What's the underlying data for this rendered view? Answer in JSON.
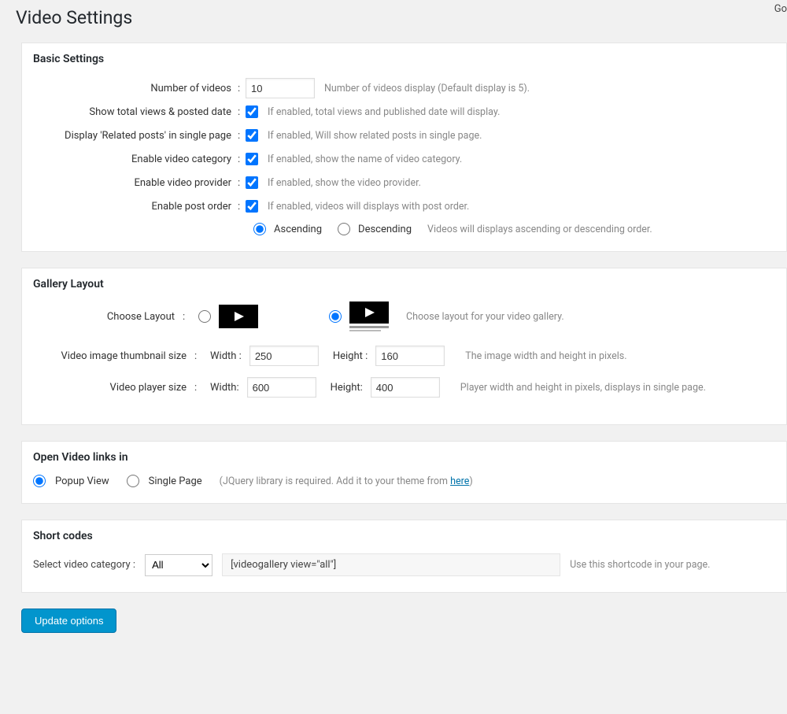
{
  "topRight": "Go",
  "pageTitle": "Video Settings",
  "basic": {
    "heading": "Basic Settings",
    "rows": {
      "numVideos": {
        "label": "Number of videos",
        "value": "10",
        "hint": "Number of videos display (Default display is 5)."
      },
      "showViews": {
        "label": "Show total views & posted date",
        "checked": true,
        "hint": "If enabled, total views and published date will display."
      },
      "related": {
        "label": "Display 'Related posts' in single page",
        "checked": true,
        "hint": "If enabled, Will show related posts in single page."
      },
      "category": {
        "label": "Enable video category",
        "checked": true,
        "hint": "If enabled, show the name of video category."
      },
      "provider": {
        "label": "Enable video provider",
        "checked": true,
        "hint": "If enabled, show the video provider."
      },
      "postOrder": {
        "label": "Enable post order",
        "checked": true,
        "hint": "If enabled, videos will displays with post order."
      }
    },
    "sort": {
      "asc": "Ascending",
      "desc": "Descending",
      "selected": "asc",
      "hint": "Videos will displays ascending or descending order."
    }
  },
  "gallery": {
    "heading": "Gallery Layout",
    "chooseLabel": "Choose Layout",
    "selected": "caption",
    "hint": "Choose layout for your video gallery.",
    "thumbSize": {
      "label": "Video image thumbnail size",
      "widthLabel": "Width :",
      "width": "250",
      "heightLabel": "Height :",
      "height": "160",
      "hint": "The image width and height in pixels."
    },
    "playerSize": {
      "label": "Video player size",
      "widthLabel": "Width:",
      "width": "600",
      "heightLabel": "Height:",
      "height": "400",
      "hint": "Player width and height in pixels, displays in single page."
    }
  },
  "openIn": {
    "heading": "Open Video links in",
    "popup": "Popup View",
    "single": "Single Page",
    "selected": "popup",
    "hintPrefix": "(JQuery library is required. Add it to your theme from ",
    "hintLink": "here",
    "hintSuffix": ")"
  },
  "shortcodes": {
    "heading": "Short codes",
    "selectLabel": "Select video category :",
    "selected": "All",
    "options": [
      "All"
    ],
    "code": "[videogallery view=\"all\"]",
    "hint": "Use this shortcode in your page."
  },
  "updateButton": "Update options"
}
